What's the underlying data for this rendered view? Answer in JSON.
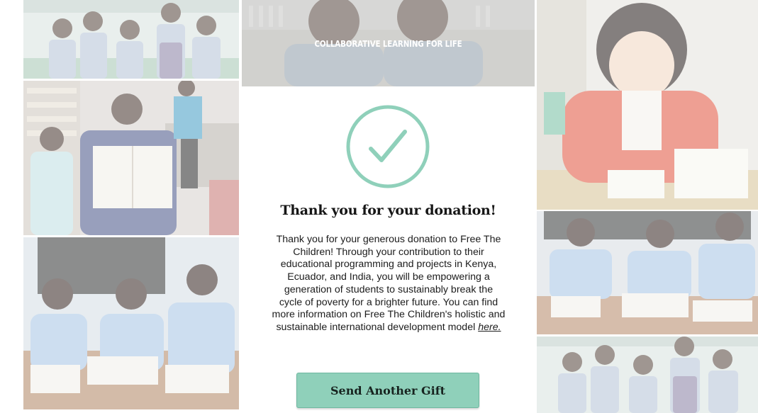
{
  "banner": {
    "tagline": "COLLABORATIVE LEARNING FOR LIFE"
  },
  "confirmation": {
    "icon": "checkmark-circle-icon",
    "accent_color": "#8fd0ba",
    "headline": "Thank you for your donation!",
    "message": "Thank you for your generous donation to Free The Children! Through your contribution to their educational programming and projects in Kenya, Ecuador, and India, you will be empowering a generation of students to sustainably break the cycle of poverty for a brighter future. You can find more information on Free The Children's holistic and sustainable international development model",
    "link_text": "here."
  },
  "actions": {
    "send_another_label": "Send Another Gift"
  },
  "photos": [
    {
      "name": "photo-group-of-students"
    },
    {
      "name": "photo-student-holding-book"
    },
    {
      "name": "photo-students-writing-at-desk"
    },
    {
      "name": "photo-girl-writing"
    },
    {
      "name": "photo-students-in-classroom"
    },
    {
      "name": "photo-group-of-students-repeat"
    }
  ]
}
